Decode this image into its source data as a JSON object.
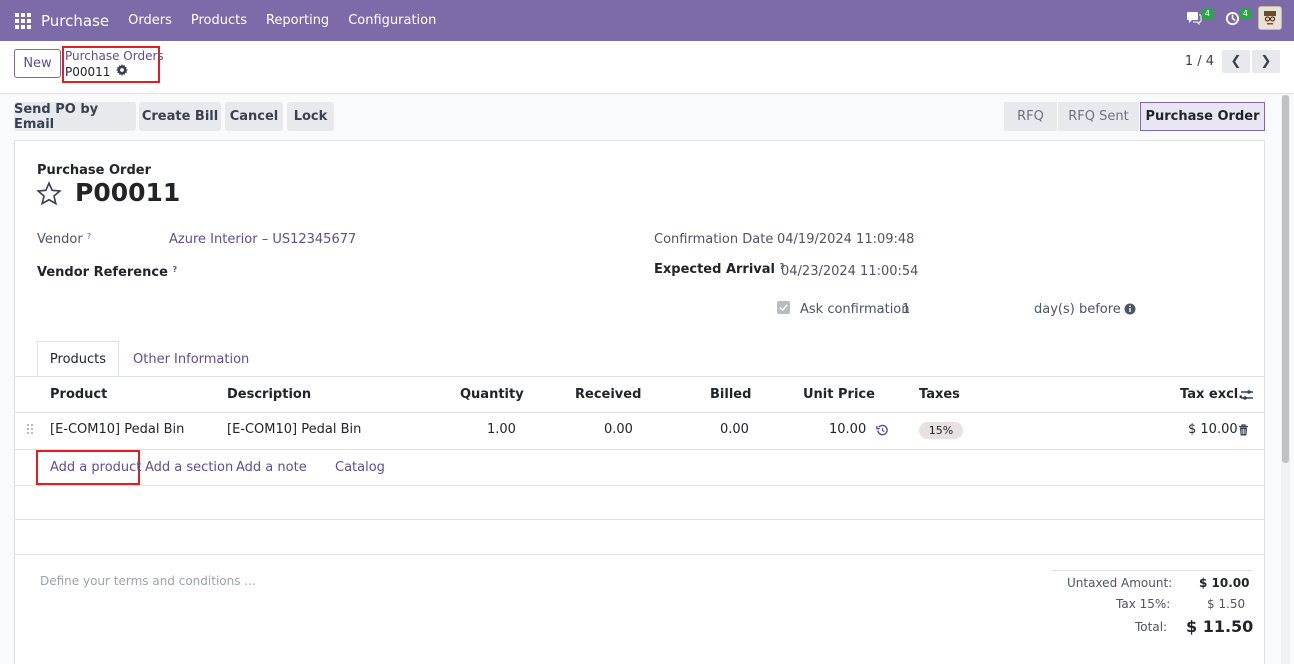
{
  "navbar": {
    "app_name": "Purchase",
    "menu": [
      "Orders",
      "Products",
      "Reporting",
      "Configuration"
    ],
    "chat_badge": "4",
    "activity_badge": "4",
    "color": "#7c6ba8"
  },
  "control_panel": {
    "new_label": "New",
    "breadcrumb_parent": "Purchase Orders",
    "breadcrumb_current": "P00011",
    "pager": "1 / 4"
  },
  "actions": [
    "Send PO by Email",
    "Create Bill",
    "Cancel",
    "Lock"
  ],
  "statusbar": [
    "RFQ",
    "RFQ Sent",
    "Purchase Order"
  ],
  "form": {
    "type_label": "Purchase Order",
    "name": "P00011",
    "vendor_label": "Vendor",
    "vendor_value": "Azure Interior – US12345677",
    "vendor_ref_label": "Vendor Reference",
    "confirmation_label": "Confirmation Date",
    "confirmation_value": "04/19/2024 11:09:48",
    "expected_label": "Expected Arrival",
    "expected_value": "04/23/2024 11:00:54",
    "ask_label": "Ask confirmation",
    "ask_days": "1",
    "ask_suffix": "day(s) before",
    "help_mark": "?"
  },
  "tabs": [
    "Products",
    "Other Information"
  ],
  "table": {
    "headers": [
      "Product",
      "Description",
      "Quantity",
      "Received",
      "Billed",
      "Unit Price",
      "Taxes",
      "Tax excl."
    ],
    "row": {
      "product": "[E-COM10] Pedal Bin",
      "description": "[E-COM10] Pedal Bin",
      "quantity": "1.00",
      "received": "0.00",
      "billed": "0.00",
      "unit_price": "10.00",
      "tax": "15%",
      "subtotal": "$ 10.00"
    },
    "add_links": [
      "Add a product",
      "Add a section",
      "Add a note",
      "Catalog"
    ]
  },
  "notes_placeholder": "Define your terms and conditions ...",
  "totals": {
    "untaxed_label": "Untaxed Amount:",
    "untaxed_value": "$ 10.00",
    "tax_label": "Tax 15%:",
    "tax_value": "$ 1.50",
    "total_label": "Total:",
    "total_value": "$ 11.50"
  }
}
